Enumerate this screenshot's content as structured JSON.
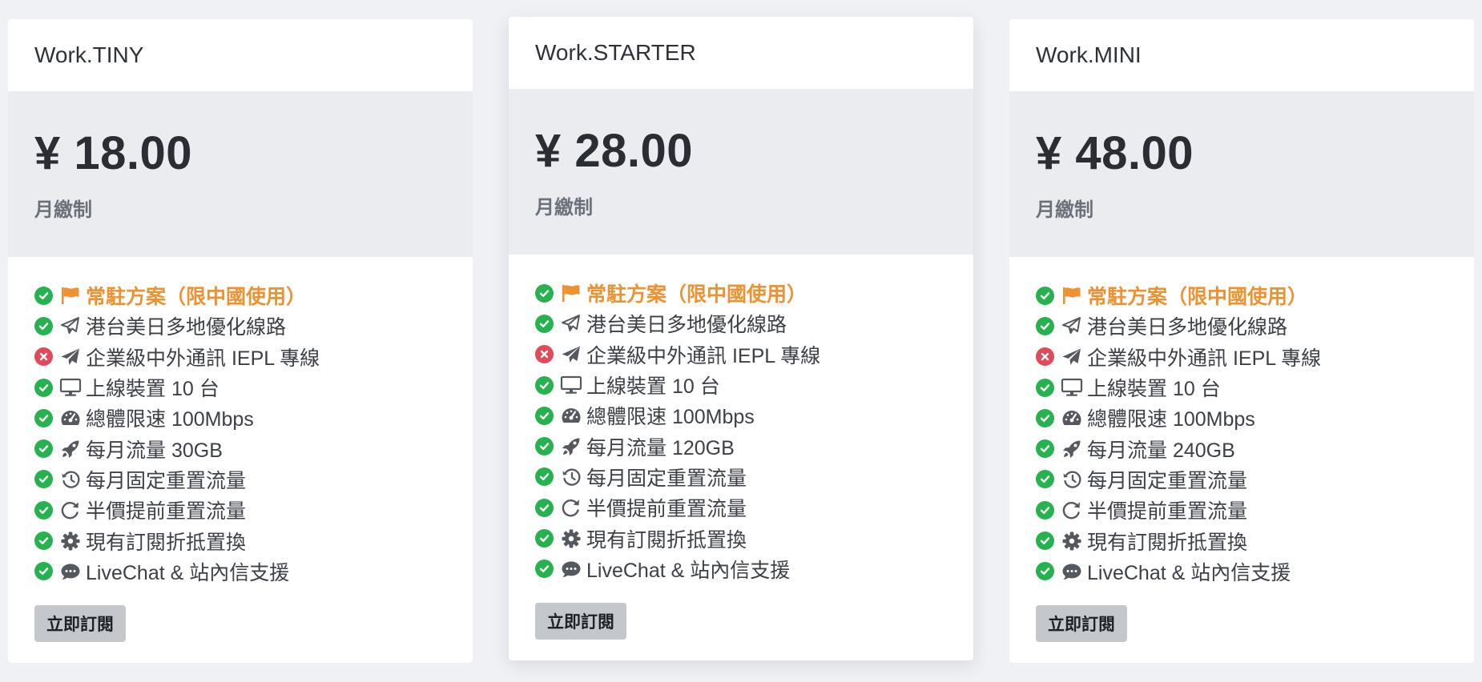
{
  "plans": [
    {
      "name": "Work.TINY",
      "price": "¥ 18.00",
      "billing": "月繳制",
      "features": [
        {
          "status": "ok",
          "icon": "flag-icon",
          "label": "常駐方案（限中國使用）",
          "highlight": true
        },
        {
          "status": "ok",
          "icon": "paper-plane-outline-icon",
          "label": "港台美日多地優化線路"
        },
        {
          "status": "no",
          "icon": "paper-plane-icon",
          "label": "企業級中外通訊 IEPL 專線"
        },
        {
          "status": "ok",
          "icon": "monitor-icon",
          "label": "上線裝置 10 台"
        },
        {
          "status": "ok",
          "icon": "speedometer-icon",
          "label": "總體限速 100Mbps"
        },
        {
          "status": "ok",
          "icon": "rocket-icon",
          "label": "每月流量 30GB"
        },
        {
          "status": "ok",
          "icon": "history-icon",
          "label": "每月固定重置流量"
        },
        {
          "status": "ok",
          "icon": "redo-icon",
          "label": "半價提前重置流量"
        },
        {
          "status": "ok",
          "icon": "gear-icon",
          "label": "現有訂閱折抵置換"
        },
        {
          "status": "ok",
          "icon": "chat-icon",
          "label": "LiveChat & 站內信支援"
        }
      ],
      "button": "立即訂閱"
    },
    {
      "name": "Work.STARTER",
      "price": "¥ 28.00",
      "billing": "月繳制",
      "features": [
        {
          "status": "ok",
          "icon": "flag-icon",
          "label": "常駐方案（限中國使用）",
          "highlight": true
        },
        {
          "status": "ok",
          "icon": "paper-plane-outline-icon",
          "label": "港台美日多地優化線路"
        },
        {
          "status": "no",
          "icon": "paper-plane-icon",
          "label": "企業級中外通訊 IEPL 專線"
        },
        {
          "status": "ok",
          "icon": "monitor-icon",
          "label": "上線裝置 10 台"
        },
        {
          "status": "ok",
          "icon": "speedometer-icon",
          "label": "總體限速 100Mbps"
        },
        {
          "status": "ok",
          "icon": "rocket-icon",
          "label": "每月流量 120GB"
        },
        {
          "status": "ok",
          "icon": "history-icon",
          "label": "每月固定重置流量"
        },
        {
          "status": "ok",
          "icon": "redo-icon",
          "label": "半價提前重置流量"
        },
        {
          "status": "ok",
          "icon": "gear-icon",
          "label": "現有訂閱折抵置換"
        },
        {
          "status": "ok",
          "icon": "chat-icon",
          "label": "LiveChat & 站內信支援"
        }
      ],
      "button": "立即訂閱"
    },
    {
      "name": "Work.MINI",
      "price": "¥ 48.00",
      "billing": "月繳制",
      "features": [
        {
          "status": "ok",
          "icon": "flag-icon",
          "label": "常駐方案（限中國使用）",
          "highlight": true
        },
        {
          "status": "ok",
          "icon": "paper-plane-outline-icon",
          "label": "港台美日多地優化線路"
        },
        {
          "status": "no",
          "icon": "paper-plane-icon",
          "label": "企業級中外通訊 IEPL 專線"
        },
        {
          "status": "ok",
          "icon": "monitor-icon",
          "label": "上線裝置 10 台"
        },
        {
          "status": "ok",
          "icon": "speedometer-icon",
          "label": "總體限速 100Mbps"
        },
        {
          "status": "ok",
          "icon": "rocket-icon",
          "label": "每月流量 240GB"
        },
        {
          "status": "ok",
          "icon": "history-icon",
          "label": "每月固定重置流量"
        },
        {
          "status": "ok",
          "icon": "redo-icon",
          "label": "半價提前重置流量"
        },
        {
          "status": "ok",
          "icon": "gear-icon",
          "label": "現有訂閱折抵置換"
        },
        {
          "status": "ok",
          "icon": "chat-icon",
          "label": "LiveChat & 站內信支援"
        }
      ],
      "button": "立即訂閱"
    }
  ],
  "colors": {
    "ok": "#27b250",
    "no": "#e24a5a",
    "highlight": "#ec9233",
    "icon": "#55595f",
    "price_band": "#ebecf0",
    "page_bg": "#f0f1f5",
    "button_bg": "#c4c7cc"
  }
}
